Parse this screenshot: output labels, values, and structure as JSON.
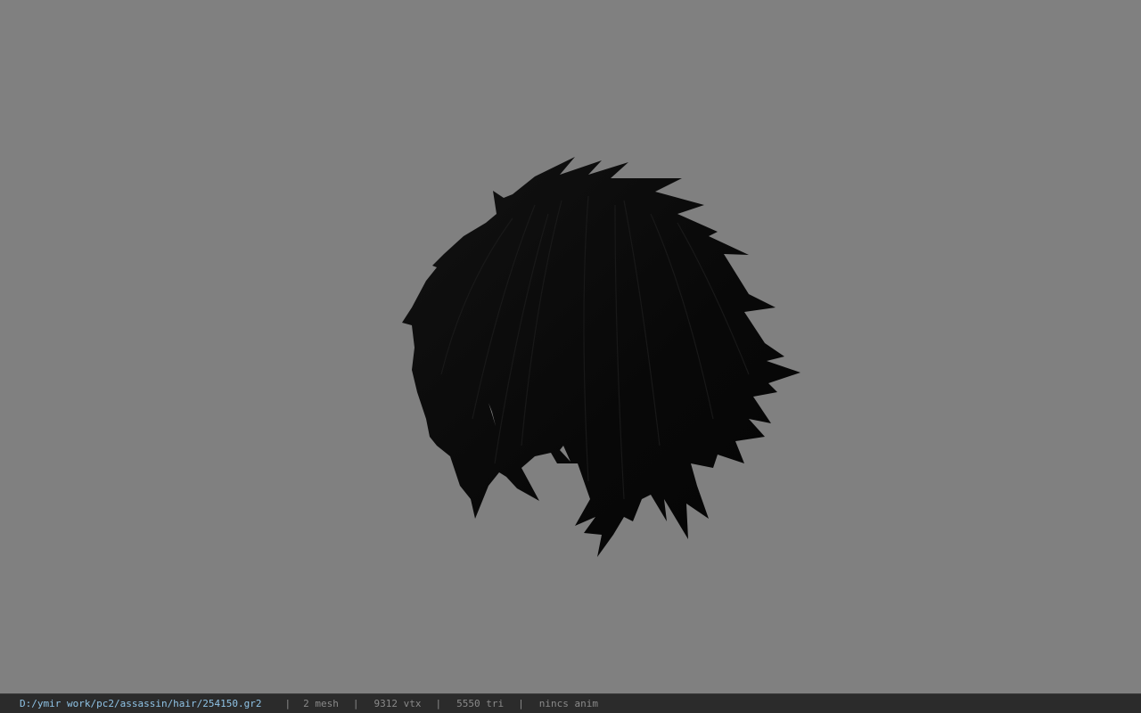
{
  "viewport": {
    "background_color": "#808080",
    "model_name": "hair-mesh",
    "model_color": "#0a0a0a"
  },
  "statusbar": {
    "path": "D:/ymir work/pc2/assassin/hair/254150.gr2",
    "separator": "|",
    "mesh_count": "2 mesh",
    "vertex_count": "9312 vtx",
    "triangle_count": "5550 tri",
    "animation": "nincs anim",
    "path_color": "#8fc3e6"
  }
}
